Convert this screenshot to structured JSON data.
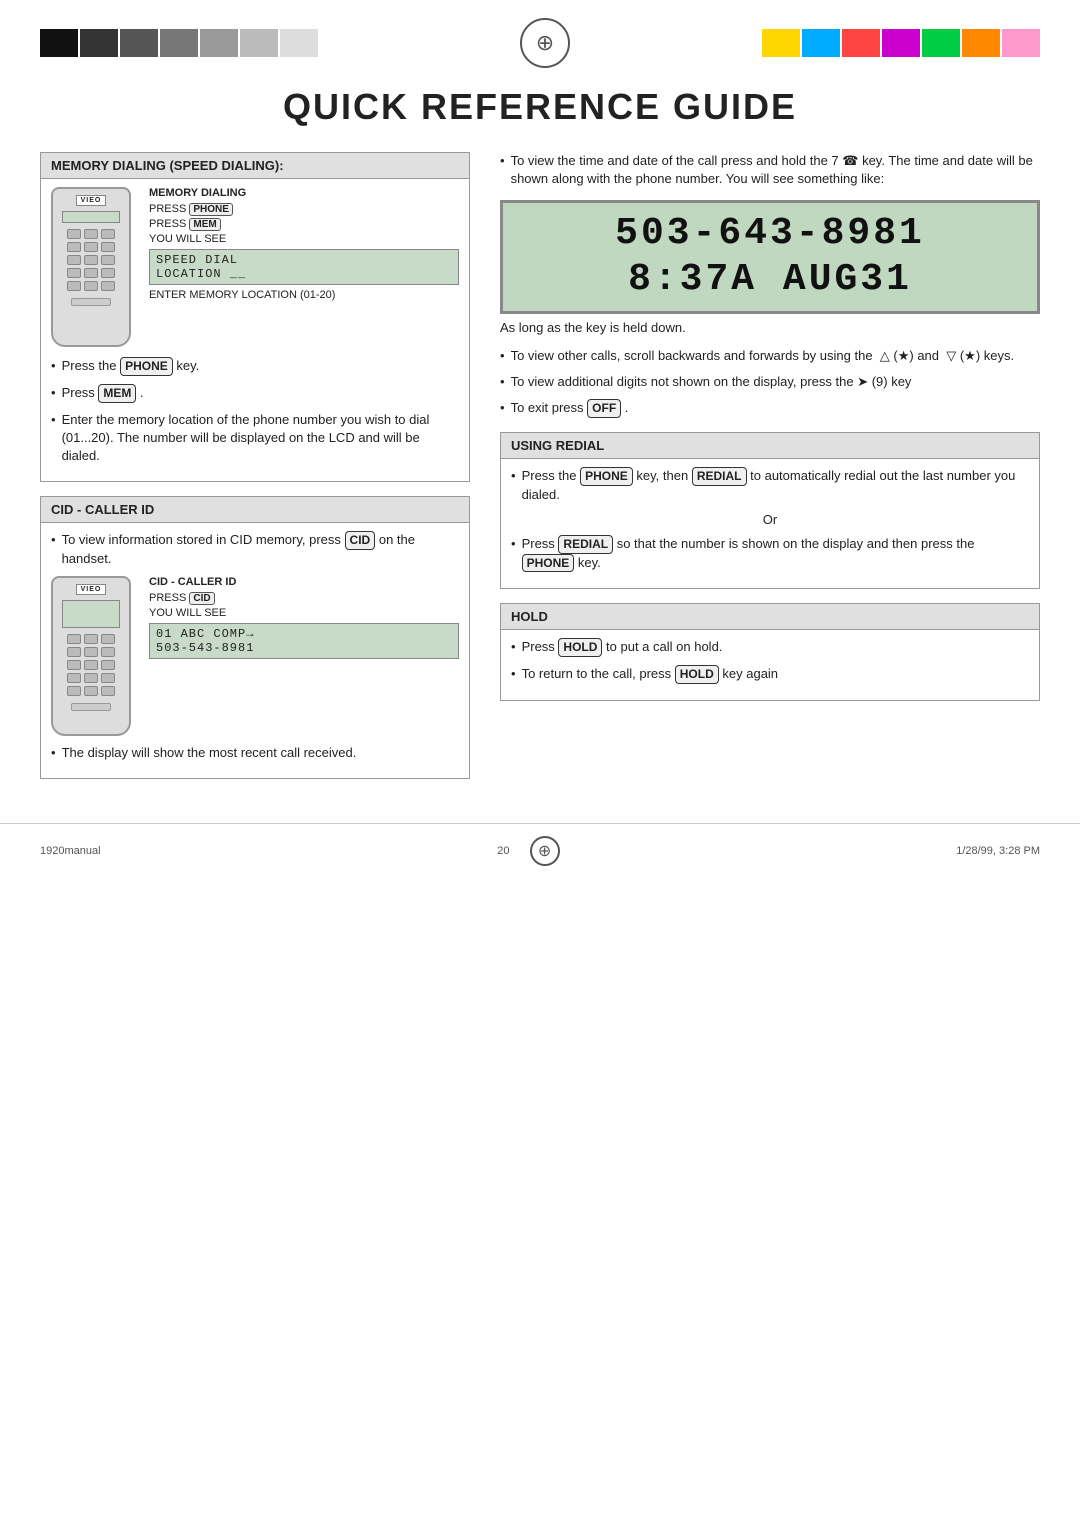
{
  "page": {
    "title": "QUICK REFERENCE GUIDE",
    "page_number": "20",
    "footer_left": "1920manual",
    "footer_center": "20",
    "footer_right": "1/28/99, 3:28 PM"
  },
  "left_column": {
    "memory_dialing_section": {
      "title": "MEMORY DIALING (SPEED DIALING):",
      "diagram": {
        "logo": "VIEO",
        "instructions_title": "MEMORY DIALING",
        "press_phone": "PRESS",
        "phone_key": "PHONE",
        "press_mem": "PRESS",
        "mem_key": "MEM",
        "you_will_see": "YOU WILL SEE",
        "lcd_line1": "SPEED DIAL",
        "lcd_line2": "LOCATION __",
        "enter_memory": "ENTER MEMORY LOCATION (01-20)"
      },
      "bullets": [
        {
          "text_before": "Press the",
          "key": "PHONE",
          "text_after": "key."
        },
        {
          "text_before": "Press",
          "key": "MEM",
          "text_after": "."
        },
        {
          "text_before": "Enter the memory location of the phone number you wish to dial (01...20). The number will be displayed on the LCD and will be dialed.",
          "key": "",
          "text_after": ""
        }
      ]
    },
    "cid_section": {
      "title": "CID - CALLER ID",
      "bullet_intro": "To view information stored in CID memory, press",
      "key": "CID",
      "bullet_intro_after": "on the handset.",
      "diagram": {
        "logo": "VIEO",
        "instructions_title": "CID - CALLER ID",
        "press": "PRESS",
        "you_will_see": "YOU WILL SEE",
        "lcd_line1": "01 ABC COMP→",
        "lcd_line2": "503-543-8981"
      },
      "bullet_display": "The display will show the most recent call received."
    }
  },
  "right_column": {
    "intro_bullets": [
      {
        "text": "To view the time and date of the call press and hold the 7",
        "key": "",
        "text2": "key. The time and date will be shown along with the phone number. You will see something like:"
      }
    ],
    "large_lcd": {
      "line1": "503-643-8981",
      "line2": "8:37A AUG31"
    },
    "held_key_text": "As long as the key is held down.",
    "scroll_bullet": "To view other calls, scroll backwards and forwards by using the",
    "scroll_keys": "▲(★) and ▼(★) keys.",
    "additional_digits_bullet": "To view additional digits not shown on the display, press the",
    "additional_key": "➤(9) key",
    "exit_bullet": "To exit press",
    "exit_key": "OFF",
    "using_redial_section": {
      "title": "USING REDIAL",
      "bullet1_before": "Press the",
      "bullet1_key1": "PHONE",
      "bullet1_mid": "key, then",
      "bullet1_key2": "REDIAL",
      "bullet1_after": "to automatically redial out the last number you dialed.",
      "or_text": "Or",
      "bullet2_before": "Press",
      "bullet2_key": "REDIAL",
      "bullet2_after": "so that the number is shown on the display and then press the",
      "bullet2_key2": "PHONE",
      "bullet2_end": "key."
    },
    "hold_section": {
      "title": "HOLD",
      "bullet1_before": "Press",
      "bullet1_key": "HOLD",
      "bullet1_after": "to put a call on hold.",
      "bullet2_before": "To return to the call, press",
      "bullet2_key": "HOLD",
      "bullet2_after": "key again"
    }
  },
  "colors": {
    "grayscale": [
      "#111",
      "#333",
      "#555",
      "#777",
      "#999",
      "#bbb",
      "#ddd"
    ],
    "color_bars": [
      "#ffd700",
      "#00aaff",
      "#ff4444",
      "#cc00cc",
      "#00cc44",
      "#ff8800",
      "#ff99cc"
    ]
  }
}
